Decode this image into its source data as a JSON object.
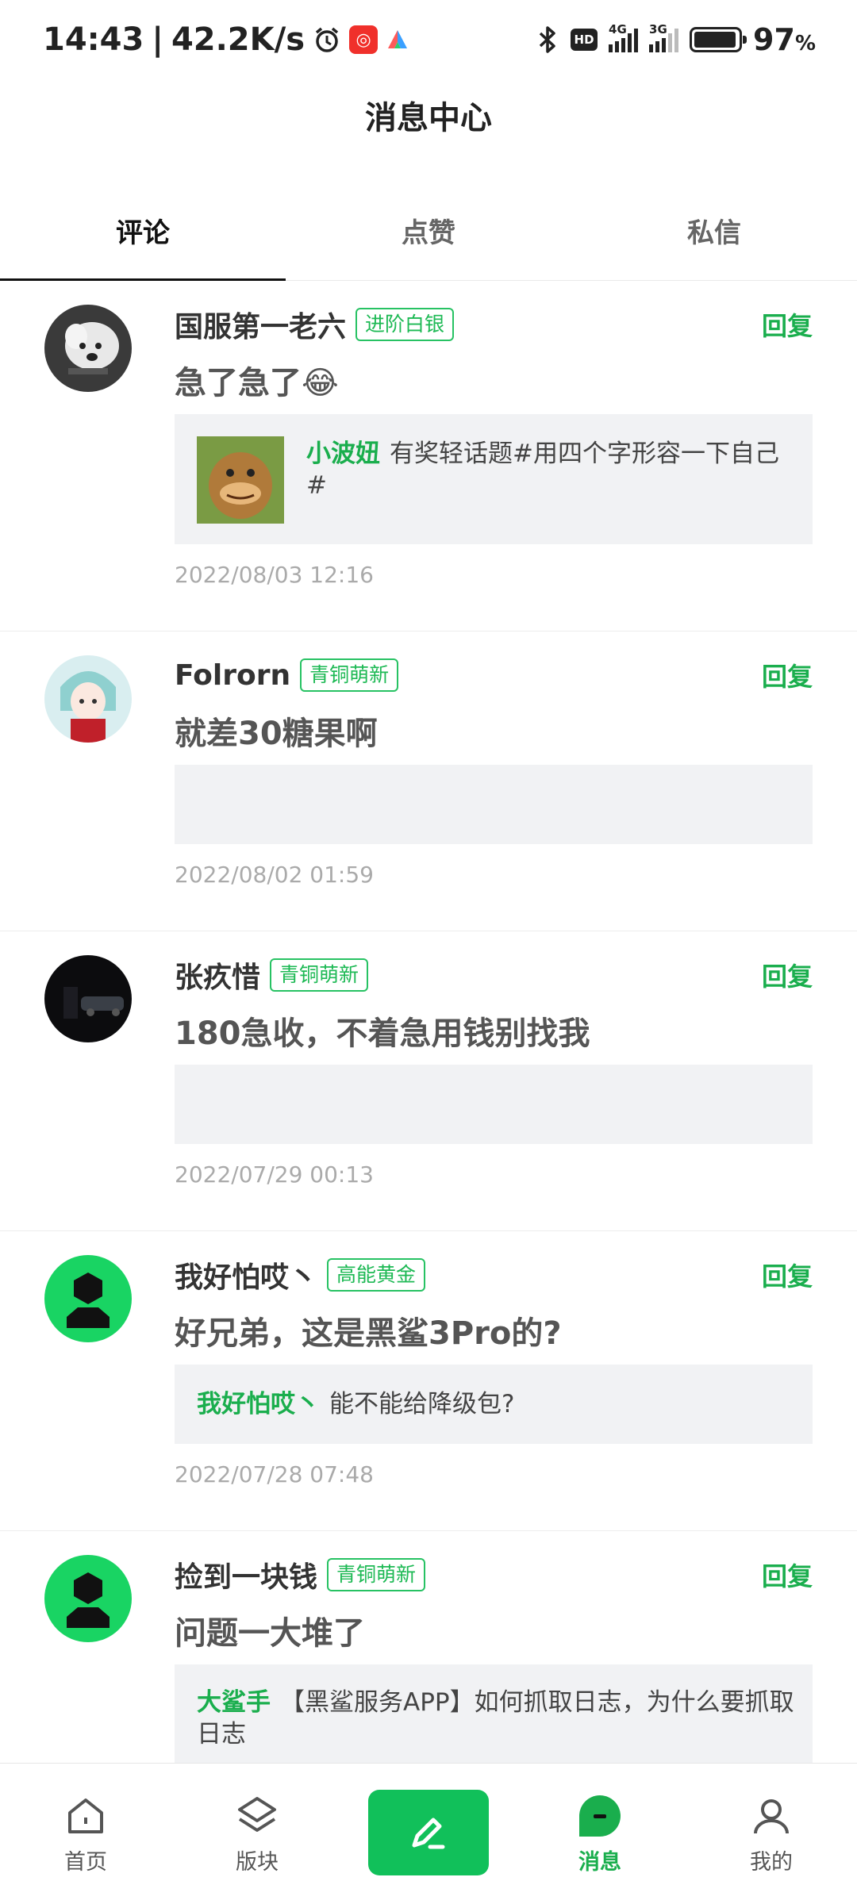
{
  "status_bar": {
    "time": "14:43",
    "separator": "|",
    "net_speed": "42.2K/s",
    "hd_label": "HD",
    "net1": "4G",
    "net2": "3G",
    "battery_percent": "97",
    "battery_level": 0.97
  },
  "header": {
    "title": "消息中心"
  },
  "tabs": [
    {
      "label": "评论",
      "active": true
    },
    {
      "label": "点赞",
      "active": false
    },
    {
      "label": "私信",
      "active": false
    }
  ],
  "comments": [
    {
      "username": "国服第一老六",
      "level": "进阶白银",
      "reply_label": "回复",
      "content": "急了急了😂",
      "quote_user": "小波妞",
      "quote_text": "有奖轻话题#用四个字形容一下自己#",
      "time": "2022/08/03 12:16"
    },
    {
      "username": "Folrorn",
      "level": "青铜萌新",
      "reply_label": "回复",
      "content": "就差30糖果啊",
      "quote_user": "",
      "quote_text": "",
      "time": "2022/08/02 01:59"
    },
    {
      "username": "张疚惜",
      "level": "青铜萌新",
      "reply_label": "回复",
      "content": "180急收，不着急用钱别找我",
      "quote_user": "",
      "quote_text": "",
      "time": "2022/07/29 00:13"
    },
    {
      "username": "我好怕哎丶",
      "level": "高能黄金",
      "reply_label": "回复",
      "content": "好兄弟，这是黑鲨3Pro的?",
      "quote_user": "我好怕哎丶",
      "quote_text": "能不能给降级包?",
      "time": "2022/07/28 07:48"
    },
    {
      "username": "捡到一块钱",
      "level": "青铜萌新",
      "reply_label": "回复",
      "content": "问题一大堆了",
      "quote_user": "大鲨手",
      "quote_text": "【黑鲨服务APP】如何抓取日志，为什么要抓取日志",
      "time": ""
    }
  ],
  "bottom_nav": [
    {
      "label": "首页",
      "icon": "home-icon"
    },
    {
      "label": "版块",
      "icon": "layers-icon"
    },
    {
      "label": "",
      "icon": "compose-icon"
    },
    {
      "label": "消息",
      "icon": "message-icon"
    },
    {
      "label": "我的",
      "icon": "profile-icon"
    }
  ],
  "colors": {
    "accent": "#1aae4d",
    "post_button": "#11c05a"
  }
}
